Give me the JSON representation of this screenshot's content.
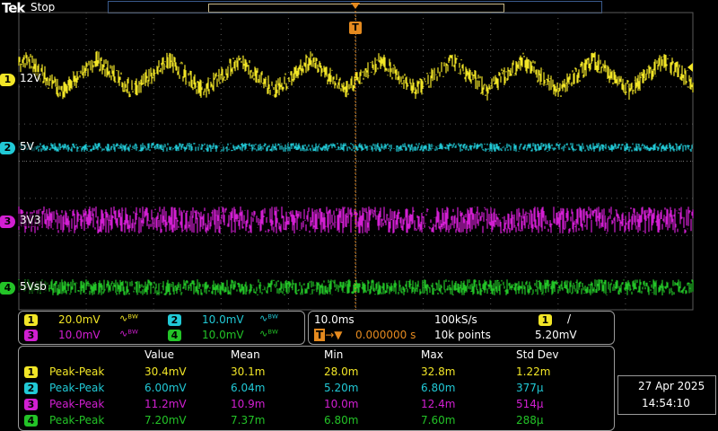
{
  "top": {
    "brand": "Tek",
    "state": "Stop"
  },
  "trigger": {
    "marker": "T"
  },
  "colors": {
    "ch1": "#f2e627",
    "ch2": "#21c9d6",
    "ch3": "#d21fd2",
    "ch4": "#23c327",
    "grid": "#5a5a5a",
    "trigger": "#e58a1f",
    "border": "#9a9a9a"
  },
  "channels": [
    {
      "num": "1",
      "label": "12V",
      "scale": "20.0mV",
      "coupling": "∿ᴮᵂ"
    },
    {
      "num": "2",
      "label": "5V",
      "scale": "10.0mV",
      "coupling": "∿ᴮᵂ"
    },
    {
      "num": "3",
      "label": "3V3",
      "scale": "10.0mV",
      "coupling": "∿ᴮᵂ"
    },
    {
      "num": "4",
      "label": "5Vsb",
      "scale": "10.0mV",
      "coupling": "∿ᴮᵂ"
    }
  ],
  "timebase": {
    "scale": "10.0ms",
    "rate": "100kS/s",
    "position": "0.000000 s",
    "points": "10k points",
    "trig_channel": "1",
    "trig_slope": "/",
    "trig_level": "5.20mV"
  },
  "measurements": {
    "headers": [
      "Value",
      "Mean",
      "Min",
      "Max",
      "Std Dev"
    ],
    "rows": [
      {
        "num": "1",
        "name": "Peak-Peak",
        "value": "30.4mV",
        "mean": "30.1m",
        "min": "28.0m",
        "max": "32.8m",
        "std": "1.22m"
      },
      {
        "num": "2",
        "name": "Peak-Peak",
        "value": "6.00mV",
        "mean": "6.04m",
        "min": "5.20m",
        "max": "6.80m",
        "std": "377µ"
      },
      {
        "num": "3",
        "name": "Peak-Peak",
        "value": "11.2mV",
        "mean": "10.9m",
        "min": "10.0m",
        "max": "12.4m",
        "std": "514µ"
      },
      {
        "num": "4",
        "name": "Peak-Peak",
        "value": "7.20mV",
        "mean": "7.37m",
        "min": "6.80m",
        "max": "7.60m",
        "std": "288µ"
      }
    ]
  },
  "datetime": {
    "date": "27 Apr  2025",
    "time": "14:54:10"
  }
}
